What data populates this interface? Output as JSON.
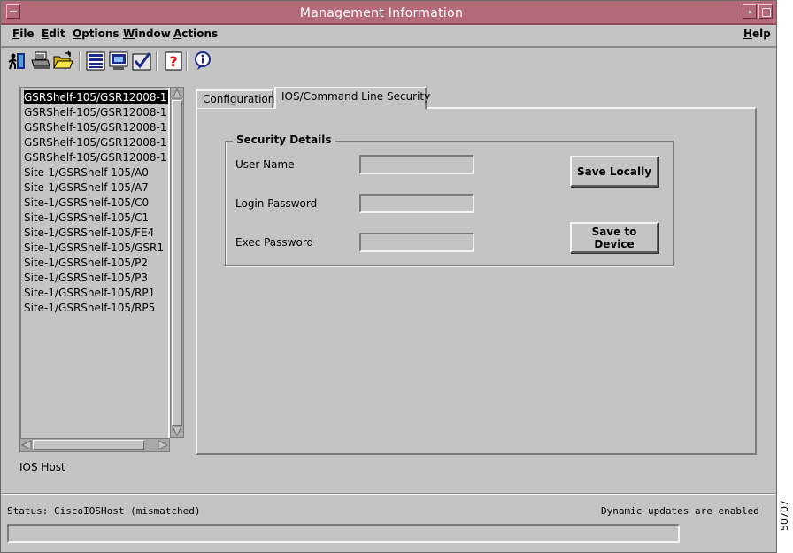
{
  "window": {
    "title": "Management Information"
  },
  "menubar": {
    "items": [
      {
        "first": "F",
        "rest": "ile"
      },
      {
        "first": "E",
        "rest": "dit"
      },
      {
        "first": "O",
        "rest": "ptions"
      },
      {
        "first": "W",
        "rest": "indow"
      },
      {
        "first": "A",
        "rest": "ctions"
      }
    ],
    "help": {
      "first": "H",
      "rest": "elp"
    }
  },
  "toolbar": {
    "icons": [
      "exit-icon",
      "print-icon",
      "open-folder-icon",
      "list-icon",
      "monitor-icon",
      "check-icon",
      "help-icon",
      "info-icon"
    ]
  },
  "tree": {
    "items": [
      "GSRShelf-105/GSR12008-1",
      "GSRShelf-105/GSR12008-1",
      "GSRShelf-105/GSR12008-1",
      "GSRShelf-105/GSR12008-1",
      "GSRShelf-105/GSR12008-1",
      "Site-1/GSRShelf-105/A0",
      "Site-1/GSRShelf-105/A7",
      "Site-1/GSRShelf-105/C0",
      "Site-1/GSRShelf-105/C1",
      "Site-1/GSRShelf-105/FE4",
      "Site-1/GSRShelf-105/GSR1",
      "Site-1/GSRShelf-105/P2",
      "Site-1/GSRShelf-105/P3",
      "Site-1/GSRShelf-105/RP1",
      "Site-1/GSRShelf-105/RP5"
    ],
    "selected_index": 0,
    "footer_label": "IOS Host"
  },
  "tabs": [
    {
      "label": "Configuration"
    },
    {
      "label": "IOS/Command Line Security"
    }
  ],
  "security": {
    "title": "Security Details",
    "user_name_label": "User Name",
    "login_password_label": "Login Password",
    "exec_password_label": "Exec Password",
    "user_name_value": "",
    "login_password_value": "",
    "exec_password_value": "",
    "save_locally": "Save Locally",
    "save_to_device": "Save to Device"
  },
  "statusbar": {
    "status": "Status: CiscoIOSHost (mismatched)",
    "dynamic": "Dynamic updates are enabled"
  },
  "figure_id": "50707",
  "colors": {
    "titlebar": "#b56a7a",
    "background": "#c4c4c4",
    "selection": "#000000"
  }
}
